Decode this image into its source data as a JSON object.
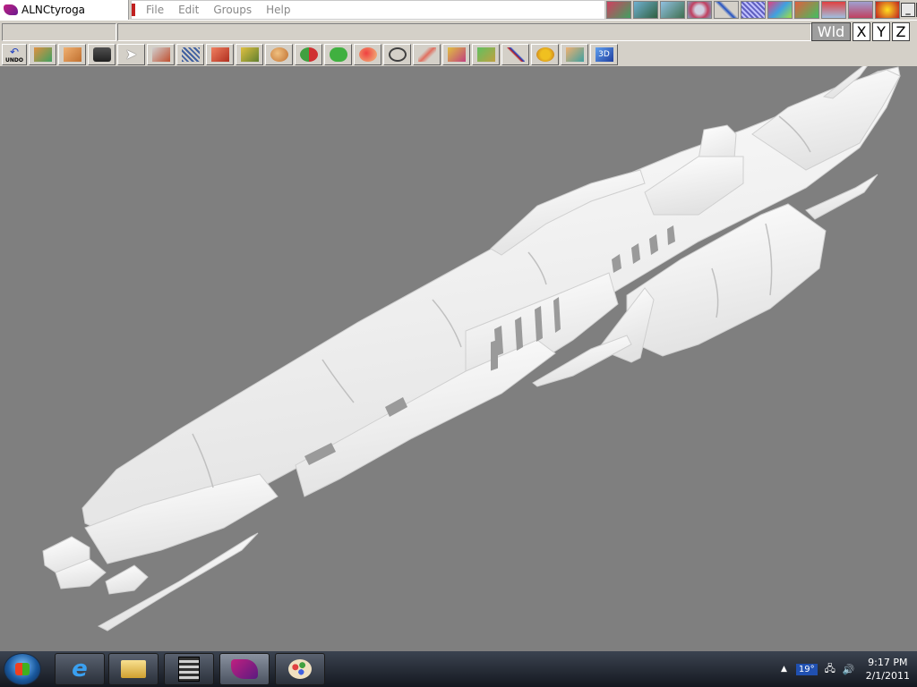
{
  "window": {
    "title": "ALNCtyroga"
  },
  "menu": {
    "items": [
      "File",
      "Edit",
      "Groups",
      "Help"
    ]
  },
  "window_controls": {
    "minimize": "_",
    "restore": "❐",
    "close": "✕"
  },
  "axis_buttons": {
    "world": "Wld",
    "x": "X",
    "y": "Y",
    "z": "Z"
  },
  "toolbar": {
    "undo_label": "UNDO",
    "tools": [
      "undo-icon",
      "box-select-icon",
      "cube-icon",
      "camera-icon",
      "arrow-select-icon",
      "move-icon",
      "rotate-icon",
      "red-cube-icon",
      "extrude-icon",
      "sphere-icon",
      "split-sphere-icon",
      "blob-icon",
      "magnet-icon",
      "lasso-icon",
      "knife-icon",
      "paint-icon",
      "box-map-icon",
      "axis-icon",
      "gear-icon",
      "texture-box-icon",
      "3d-view-icon"
    ],
    "view_3d_label": "3D"
  },
  "taskbar": {
    "apps": [
      "internet-explorer-icon",
      "folder-icon",
      "calculator-icon",
      "modeler-app-icon",
      "paint-icon"
    ],
    "temperature": "19°",
    "time": "9:17 PM",
    "date": "2/1/2011"
  },
  "colors": {
    "viewport": "#7f7f7f",
    "model": "#f2f2f2",
    "chrome": "#d4d0c8"
  }
}
